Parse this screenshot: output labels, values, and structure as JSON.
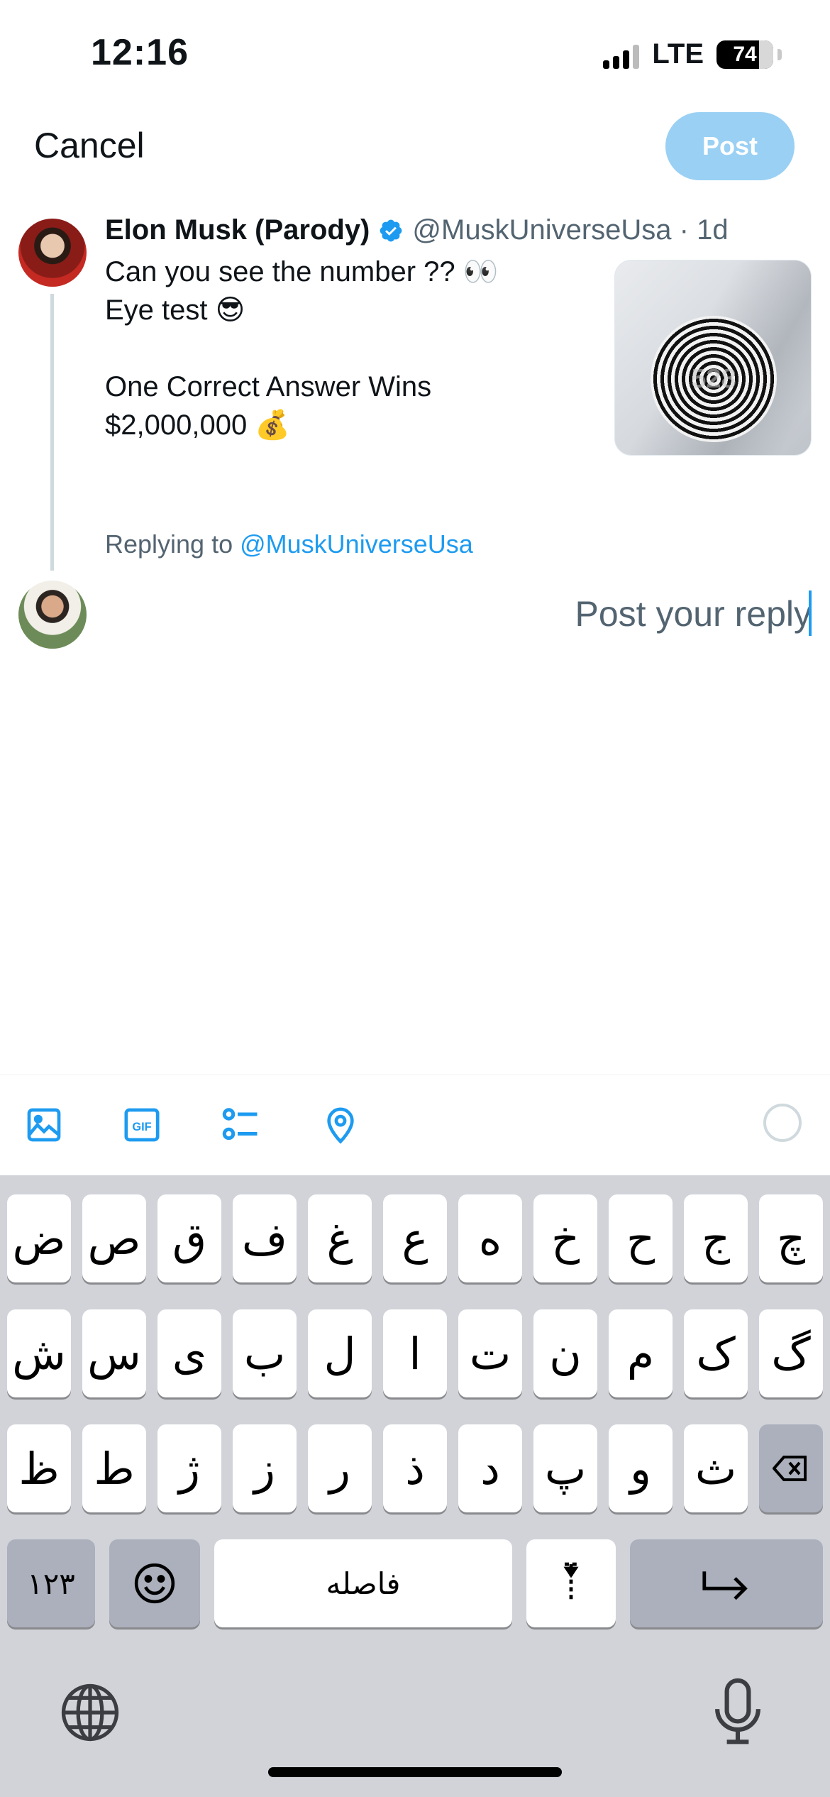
{
  "status_bar": {
    "time": "12:16",
    "network": "LTE",
    "battery": "74"
  },
  "header": {
    "cancel_label": "Cancel",
    "post_label": "Post"
  },
  "tweet": {
    "author_name": "Elon Musk (Parody)",
    "handle_meta": "@MuskUniverseUsa · 1d",
    "text": "Can you see the number ?? 👀\nEye test 😎\n\nOne Correct Answer Wins\n$2,000,000 💰",
    "image_overlay_text": "528"
  },
  "reply": {
    "replying_prefix": "Replying to",
    "replying_mention": "@MuskUniverseUsa",
    "placeholder": "Post your reply"
  },
  "toolbar": {
    "icons": [
      "image-icon",
      "gif-icon",
      "poll-icon",
      "location-icon"
    ],
    "gif_label": "GIF"
  },
  "keyboard": {
    "row1": [
      "چ",
      "ج",
      "ح",
      "خ",
      "ه",
      "ع",
      "غ",
      "ف",
      "ق",
      "ص",
      "ض"
    ],
    "row2": [
      "گ",
      "ک",
      "م",
      "ن",
      "ت",
      "ا",
      "ل",
      "ب",
      "ی",
      "س",
      "ش"
    ],
    "row3": [
      "ث",
      "و",
      "پ",
      "د",
      "ذ",
      "ر",
      "ز",
      "ژ",
      "ط",
      "ظ"
    ],
    "numbers_label": "۱۲۳",
    "space_label": "فاصله"
  },
  "colors": {
    "accent": "#1d9bf0",
    "post_disabled": "#9ad0f4",
    "keyboard_bg": "#d1d3d9"
  }
}
